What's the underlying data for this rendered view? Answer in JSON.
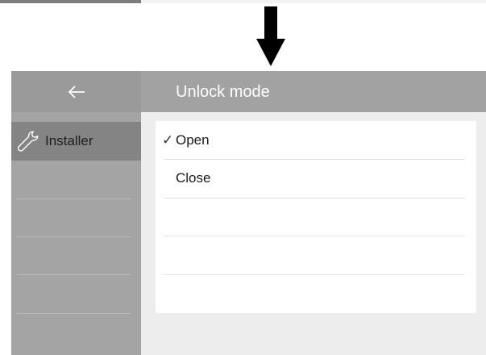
{
  "header": {
    "back_icon": "left-arrow-icon",
    "title": "Unlock mode"
  },
  "sidebar": {
    "items": [
      {
        "icon": "wrench-icon",
        "label": "Installer",
        "active": true
      }
    ]
  },
  "options": [
    {
      "label": "Open",
      "selected": true,
      "check_symbol": "✓"
    },
    {
      "label": "Close",
      "selected": false,
      "check_symbol": ""
    }
  ],
  "transition_icon": "down-arrow-icon",
  "colors": {
    "topbar": "#a2a2a2",
    "sidebar": "#a4a4a4",
    "sidebar_active": "#848484",
    "screen_background": "#ededed",
    "panel": "#ffffff"
  }
}
